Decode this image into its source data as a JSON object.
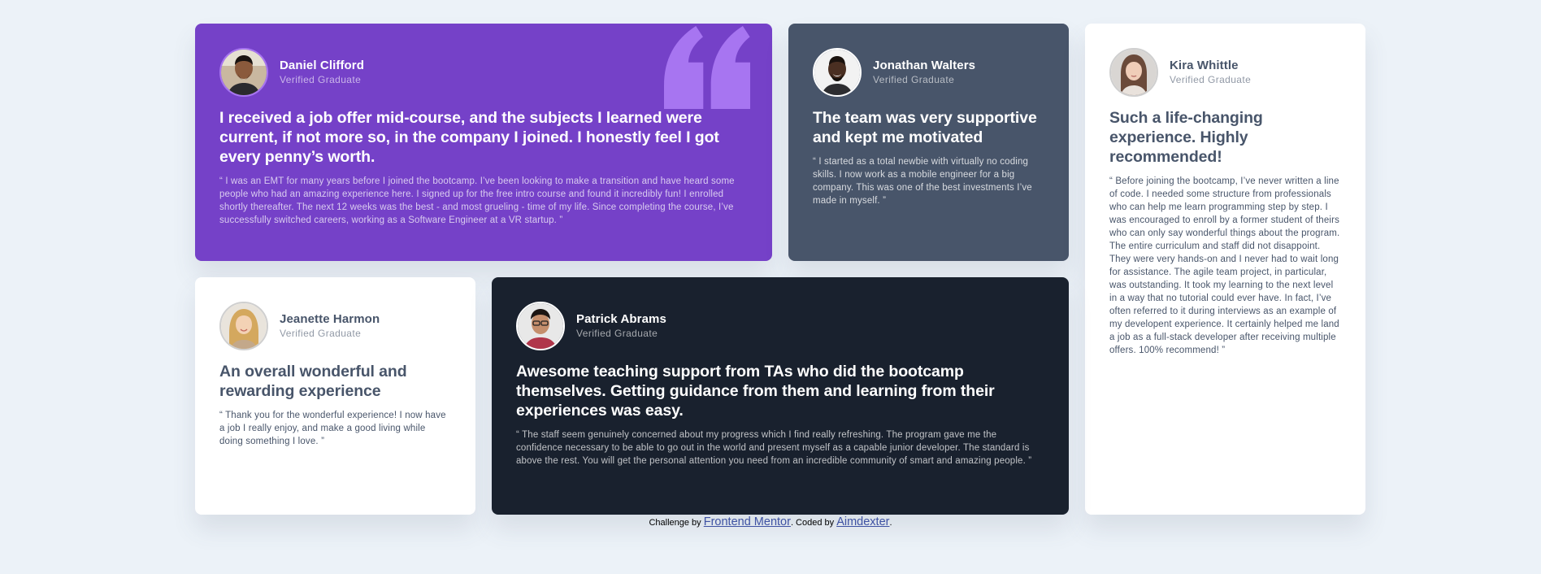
{
  "colors": {
    "background": "#ecf2f8",
    "purple": "#7541c8",
    "grayish_blue": "#48556a",
    "dark_blackish_blue": "#19212e",
    "white": "#ffffff",
    "quote_mark": "#a775f1",
    "link": "#3e52a3"
  },
  "testimonials": [
    {
      "name": "Daniel Clifford",
      "role": "Verified Graduate",
      "avatar": "daniel-avatar",
      "headline": "I received a job offer mid-course, and the subjects I learned were current, if not more so, in the company I joined. I honestly feel I got every penny’s worth.",
      "body": "“ I was an EMT for many years before I joined the bootcamp. I’ve been looking to make a transition and have heard some people who had an amazing experience here. I signed up for the free intro course and found it incredibly fun! I enrolled shortly thereafter. The next 12 weeks was the best - and most grueling - time of my life. Since completing the course, I’ve successfully switched careers, working as a Software Engineer at a VR startup. ”"
    },
    {
      "name": "Jonathan Walters",
      "role": "Verified Graduate",
      "avatar": "jonathan-avatar",
      "headline": "The team was very supportive and kept me motivated",
      "body": "“ I started as a total newbie with virtually no coding skills. I now work as a mobile engineer for a big company. This was one of the best investments I’ve made in myself. ”"
    },
    {
      "name": "Kira Whittle",
      "role": "Verified Graduate",
      "avatar": "kira-avatar",
      "headline": "Such a life-changing experience. Highly recommended!",
      "body": "“ Before joining the bootcamp, I’ve never written a line of code. I needed some structure from professionals who can help me learn programming step by step. I was encouraged to enroll by a former student of theirs who can only say wonderful things about the program. The entire curriculum and staff did not disappoint. They were very hands-on and I never had to wait long for assistance. The agile team project, in particular, was outstanding. It took my learning to the next level in a way that no tutorial could ever have. In fact, I’ve often referred to it during interviews as an example of my developent experience. It certainly helped me land a job as a full-stack developer after receiving multiple offers. 100% recommend! ”"
    },
    {
      "name": "Jeanette Harmon",
      "role": "Verified Graduate",
      "avatar": "jeanette-avatar",
      "headline": "An overall wonderful and rewarding experience",
      "body": "“ Thank you for the wonderful experience! I now have a job I really enjoy, and make a good living while doing something I love. ”"
    },
    {
      "name": "Patrick Abrams",
      "role": "Verified Graduate",
      "avatar": "patrick-avatar",
      "headline": "Awesome teaching support from TAs who did the bootcamp themselves. Getting guidance from them and learning from their experiences was easy.",
      "body": "“ The staff seem genuinely concerned about my progress which I find really refreshing. The program gave me the confidence necessary to be able to go out in the world and present myself as a capable junior developer. The standard is above the rest. You will get the personal attention you need from an incredible community of smart and amazing people. ”"
    }
  ],
  "attribution": {
    "prefix": "Challenge by",
    "link1": "Frontend Mentor",
    "middle": ". Coded by",
    "link2": "Aimdexter",
    "suffix": "."
  }
}
